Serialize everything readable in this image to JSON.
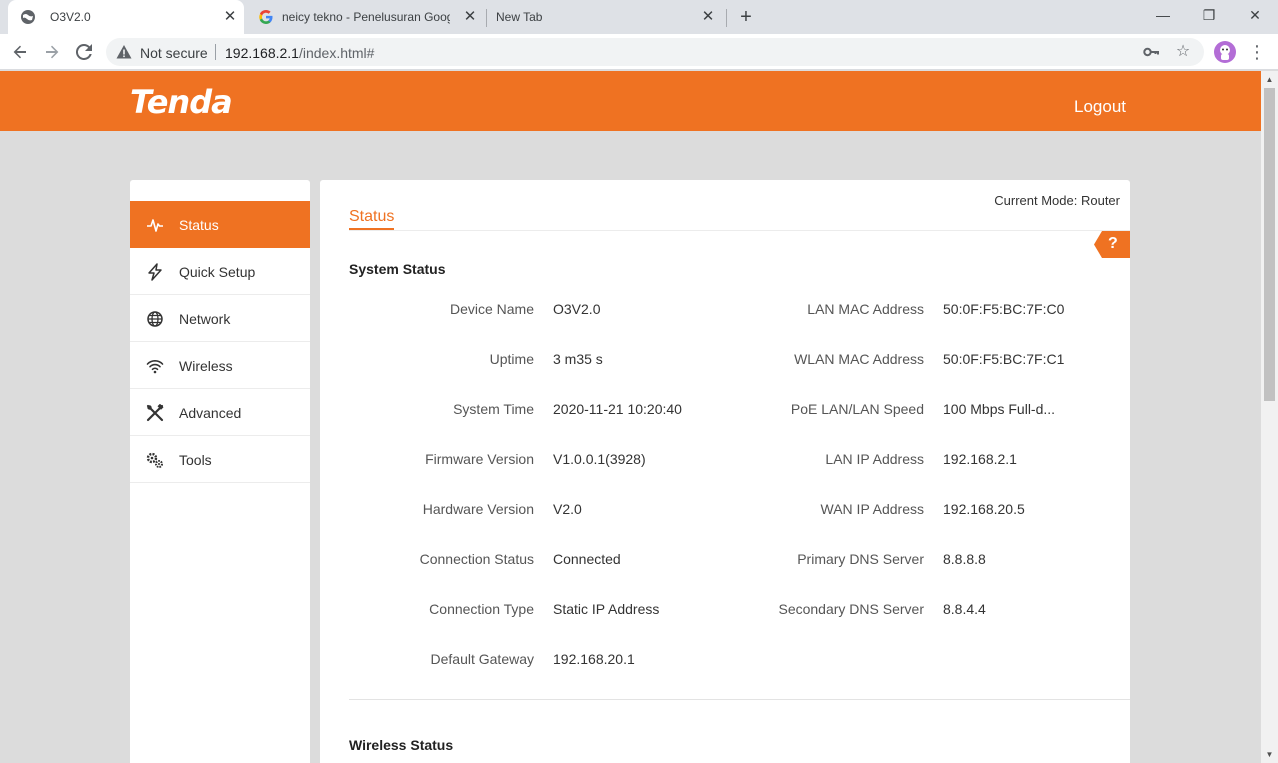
{
  "browser": {
    "tabs": [
      {
        "title": "O3V2.0"
      },
      {
        "title": "neicy tekno - Penelusuran Googl"
      },
      {
        "title": "New Tab"
      }
    ],
    "new_tab": "+",
    "window_controls": {
      "minimize": "—",
      "restore": "❐",
      "close": "✕"
    },
    "address": {
      "security_label": "Not secure",
      "host": "192.168.2.1",
      "path": "/index.html#"
    }
  },
  "header": {
    "logo": "Tenda",
    "logout_label": "Logout"
  },
  "sidebar": {
    "items": [
      {
        "label": "Status",
        "icon": "pulse-icon",
        "active": true
      },
      {
        "label": "Quick Setup",
        "icon": "lightning-icon"
      },
      {
        "label": "Network",
        "icon": "globe-icon"
      },
      {
        "label": "Wireless",
        "icon": "wifi-icon"
      },
      {
        "label": "Advanced",
        "icon": "tools-icon"
      },
      {
        "label": "Tools",
        "icon": "gears-icon"
      }
    ]
  },
  "content": {
    "current_mode": "Current Mode: Router",
    "page_title": "Status",
    "help": "?",
    "system_status": {
      "title": "System Status",
      "left": [
        {
          "label": "Device Name",
          "value": "O3V2.0"
        },
        {
          "label": "Uptime",
          "value": "3 m35 s"
        },
        {
          "label": "System Time",
          "value": "2020-11-21 10:20:40"
        },
        {
          "label": "Firmware Version",
          "value": "V1.0.0.1(3928)"
        },
        {
          "label": "Hardware Version",
          "value": "V2.0"
        },
        {
          "label": "Connection Status",
          "value": "Connected"
        },
        {
          "label": "Connection Type",
          "value": "Static IP Address"
        },
        {
          "label": "Default Gateway",
          "value": "192.168.20.1"
        }
      ],
      "right": [
        {
          "label": "LAN MAC Address",
          "value": "50:0F:F5:BC:7F:C0"
        },
        {
          "label": "WLAN MAC Address",
          "value": "50:0F:F5:BC:7F:C1"
        },
        {
          "label": "PoE LAN/LAN Speed",
          "value": "100 Mbps Full-d..."
        },
        {
          "label": "LAN IP Address",
          "value": "192.168.2.1"
        },
        {
          "label": "WAN IP Address",
          "value": "192.168.20.5"
        },
        {
          "label": "Primary DNS Server",
          "value": "8.8.8.8"
        },
        {
          "label": "Secondary DNS Server",
          "value": "8.8.4.4"
        }
      ]
    },
    "wireless_status": {
      "title": "Wireless Status"
    }
  },
  "colors": {
    "brand": "#ef7222",
    "page_bg": "#dcdcdc"
  }
}
